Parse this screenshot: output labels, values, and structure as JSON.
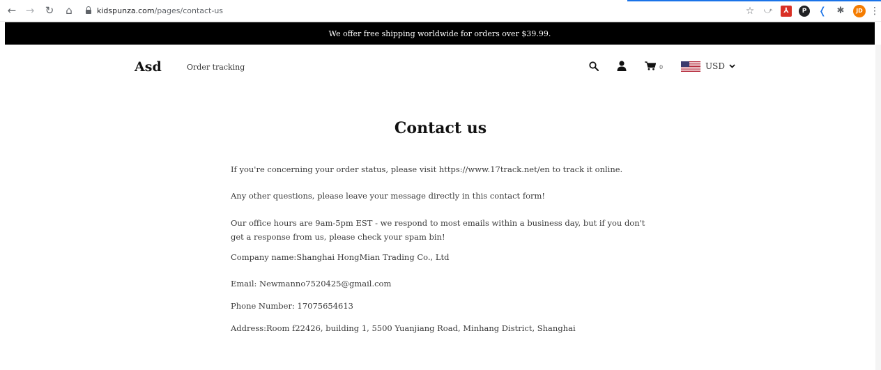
{
  "browser": {
    "url_domain": "kidspunza.com",
    "url_path": "/pages/contact-us",
    "extensions": {
      "pdf_icon_glyph": "⅄",
      "pin_icon_glyph": "P",
      "profile_initials": "JD"
    }
  },
  "announcement": {
    "text": "We offer free shipping worldwide for orders over $39.99."
  },
  "header": {
    "logo": "Asd",
    "nav_link": "Order tracking",
    "cart_count": "0",
    "currency": "USD"
  },
  "main": {
    "title": "Contact us",
    "paragraphs": [
      "If you're concerning your order status, please visit https://www.17track.net/en to track it online.",
      "Any other questions, please leave your message directly in this contact form!",
      "Our office hours are 9am-5pm EST - we respond to most emails within a business day, but if you don't get a response from us, please check your spam bin!",
      "Company name:Shanghai HongMian Trading Co., Ltd",
      "Email: Newmanno7520425@gmail.com",
      "Phone Number: 17075654613",
      "Address:Room f22426, building 1, 5500 Yuanjiang Road, Minhang District, Shanghai"
    ]
  },
  "colors": {
    "announcement_bg": "#000000",
    "browser_accent": "#1a73e8",
    "profile_badge": "#f57c00"
  }
}
